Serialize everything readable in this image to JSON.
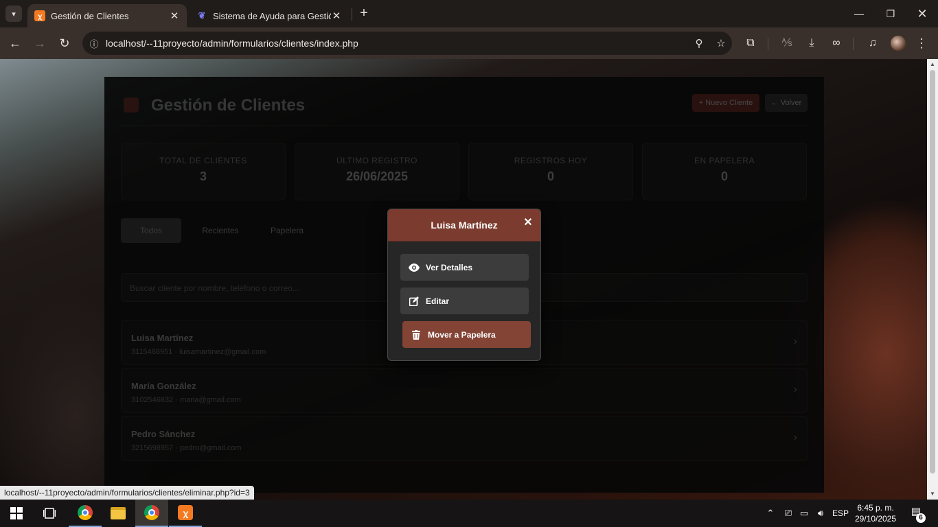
{
  "browser": {
    "tabs": [
      {
        "title": "Gestión de Clientes",
        "active": true
      },
      {
        "title": "Sistema de Ayuda para Gestión",
        "active": false
      }
    ],
    "url": "localhost/--11proyecto/admin/formularios/clientes/index.php",
    "status_url": "localhost/--11proyecto/admin/formularios/clientes/eliminar.php?id=3"
  },
  "page": {
    "title": "Gestión de Clientes",
    "buttons": {
      "new": "+ Nuevo Cliente",
      "back": "← Volver"
    },
    "stats": [
      {
        "label": "TOTAL DE CLIENTES",
        "value": "3"
      },
      {
        "label": "ÚLTIMO REGISTRO",
        "value": "26/06/2025"
      },
      {
        "label": "REGISTROS HOY",
        "value": "0"
      },
      {
        "label": "EN PAPELERA",
        "value": "0"
      }
    ],
    "tabs": [
      "Todos",
      "Recientes",
      "Papelera"
    ],
    "search_placeholder": "Buscar cliente por nombre, teléfono o correo...",
    "clients": [
      {
        "name": "Luisa Martínez",
        "info": "3115468951 · luisamartinez@gmail.com"
      },
      {
        "name": "María González",
        "info": "3102546832 · maria@gmail.com"
      },
      {
        "name": "Pedro Sánchez",
        "info": "3215698957 · pedro@gmail.com"
      }
    ]
  },
  "modal": {
    "title": "Luisa Martínez",
    "actions": {
      "details": "Ver Detalles",
      "edit": "Editar",
      "trash": "Mover a Papelera"
    }
  },
  "taskbar": {
    "lang": "ESP",
    "time": "6:45 p. m.",
    "date": "29/10/2025",
    "notifications": "6"
  },
  "colors": {
    "modal_header": "#7b3b2e",
    "danger_button": "#834335",
    "xampp": "#f47a21"
  }
}
